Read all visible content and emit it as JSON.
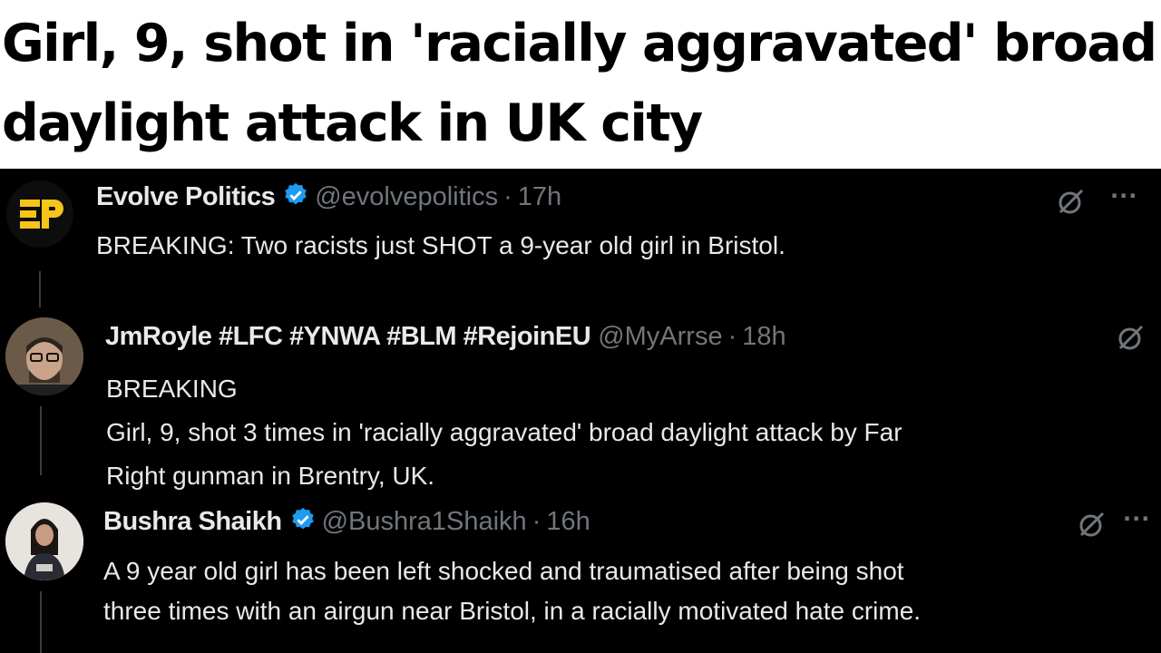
{
  "headline": "Girl, 9, shot in 'racially aggravated' broad daylight attack in UK city",
  "tweets": [
    {
      "name": "Evolve Politics",
      "handle": "@evolvepolitics",
      "time": "17h",
      "verified": true,
      "text_lines": [
        "BREAKING: Two racists just SHOT a 9-year old girl in Bristol."
      ],
      "avatar_icon": "evolve-politics-logo",
      "avatar_text": "EP"
    },
    {
      "name": "JmRoyle #LFC #YNWA #BLM #RejoinEU",
      "handle": "@MyArrse",
      "time": "18h",
      "verified": false,
      "text_lines": [
        "BREAKING",
        "Girl, 9, shot 3 times in 'racially aggravated' broad daylight attack by Far",
        "Right gunman in Brentry, UK."
      ],
      "avatar_icon": "user-photo-avatar"
    },
    {
      "name": "Bushra Shaikh",
      "handle": "@Bushra1Shaikh",
      "time": "16h",
      "verified": true,
      "text_lines": [
        "A 9 year old girl has been left shocked and traumatised after being shot",
        "three times with an airgun near Bristol, in a racially motivated hate crime."
      ],
      "avatar_icon": "user-photo-avatar"
    }
  ],
  "icons": {
    "grok": "grok-icon",
    "more": "···"
  },
  "colors": {
    "background": "#000000",
    "text": "#e7e9ea",
    "muted": "#71767b",
    "verified": "#1d9bf0",
    "logo_yellow": "#f5c518"
  }
}
